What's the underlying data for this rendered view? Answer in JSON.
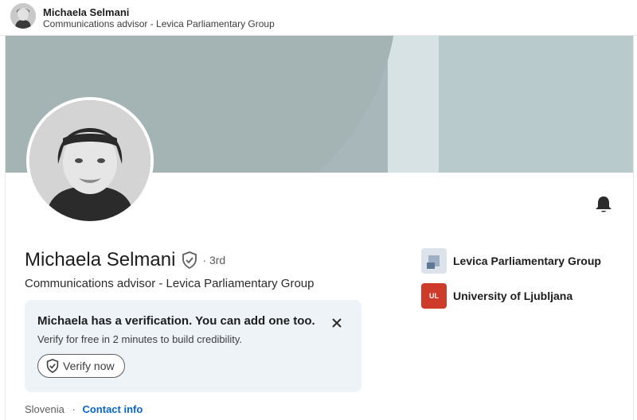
{
  "topbar": {
    "name": "Michaela Selmani",
    "headline": "Communications advisor - Levica Parliamentary Group"
  },
  "profile": {
    "name": "Michaela Selmani",
    "degree": "· 3rd",
    "headline": "Communications advisor - Levica Parliamentary Group",
    "location": "Slovenia",
    "separator": "·",
    "contact_info": "Contact info"
  },
  "promo": {
    "title": "Michaela has a verification. You can add one too.",
    "subtitle": "Verify for free in 2 minutes to build credibility.",
    "button_label": "Verify now"
  },
  "organizations": [
    {
      "name": "Levica Parliamentary Group",
      "logo_text": ""
    },
    {
      "name": "University of Ljubljana",
      "logo_text": "UL"
    }
  ],
  "icons": {
    "bell": "bell-icon",
    "verified": "verified-shield-icon",
    "close": "close-icon"
  },
  "colors": {
    "link": "#0a66c2",
    "promo_bg": "#eef3f8",
    "cover": "#a8b8ba",
    "ul_logo": "#cf3b2b"
  }
}
